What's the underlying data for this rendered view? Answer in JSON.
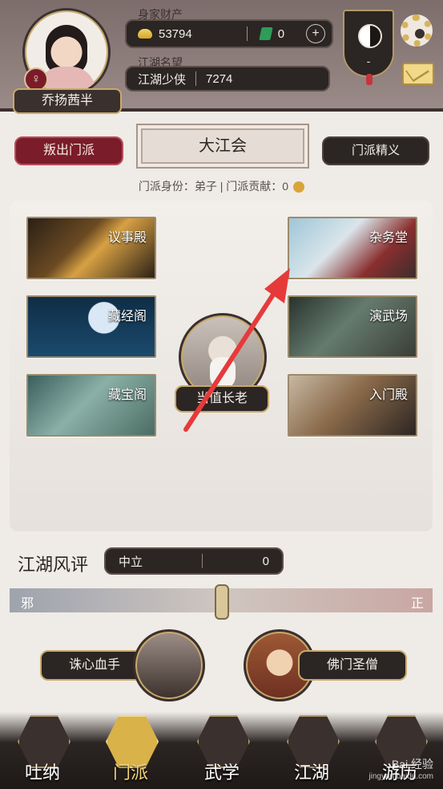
{
  "player": {
    "name": "乔扬茜半",
    "gender_symbol": "♀",
    "wealth_label": "身家财产",
    "silver": "53794",
    "jade": "0",
    "reputation_label": "江湖名望",
    "reputation_title": "江湖少侠",
    "reputation_value": "7274"
  },
  "header": {
    "emblem_text": "-",
    "icons": [
      "plus-icon",
      "yinyang-icon",
      "gear-icon",
      "mail-icon"
    ]
  },
  "faction": {
    "leave_button": "叛出门派",
    "name": "大江会",
    "essence_button": "门派精义",
    "info": "门派身份：弟子 | 门派贡献：0"
  },
  "buildings": [
    {
      "id": "yishidian",
      "label": "议事殿"
    },
    {
      "id": "cangjingge",
      "label": "藏经阁"
    },
    {
      "id": "cangbaoge",
      "label": "藏宝阁"
    },
    {
      "id": "zawutang",
      "label": "杂务堂"
    },
    {
      "id": "yanwuchang",
      "label": "演武场"
    },
    {
      "id": "rumendian",
      "label": "入门殿"
    }
  ],
  "elder": {
    "label": "当值长老"
  },
  "reputation": {
    "title": "江湖风评",
    "status": "中立",
    "value": "0",
    "left_label": "邪",
    "right_label": "正"
  },
  "npcs": [
    {
      "label": "诛心血手"
    },
    {
      "label": "佛门圣僧"
    }
  ],
  "bottom_nav": [
    {
      "label": "吐纳",
      "active": false
    },
    {
      "label": "门派",
      "active": true
    },
    {
      "label": "武学",
      "active": false
    },
    {
      "label": "江湖",
      "active": false
    },
    {
      "label": "游历",
      "active": false
    }
  ],
  "watermark": {
    "line1": "Bai 经验",
    "line2": "jingyan.baidu.com"
  },
  "colors": {
    "accent_red": "#7a1c2a",
    "dark_pill": "#2b2523",
    "gold": "#c9a96b",
    "arrow_red": "#e63a3a"
  }
}
